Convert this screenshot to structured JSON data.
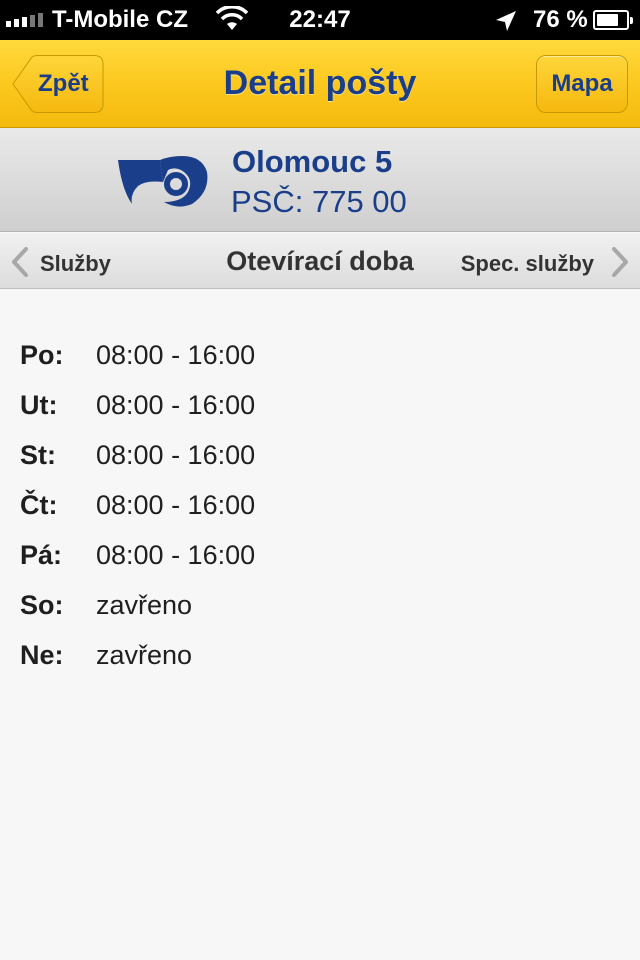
{
  "status_bar": {
    "carrier": "T-Mobile CZ",
    "time": "22:47",
    "battery": "76 %",
    "battery_level": 0.76
  },
  "nav": {
    "back_label": "Zpět",
    "title": "Detail pošty",
    "map_label": "Mapa",
    "accent_color": "#fcc81f",
    "text_color": "#1a3e8a"
  },
  "office": {
    "name": "Olomouc 5",
    "zip": "PSČ: 775 00",
    "logo_icon": "posthorn-icon"
  },
  "sections": {
    "prev_label": "Služby",
    "current_label": "Otevírací doba",
    "next_label": "Spec. služby"
  },
  "hours": [
    {
      "day": "Po:",
      "time": "08:00 - 16:00"
    },
    {
      "day": "Ut:",
      "time": "08:00 - 16:00"
    },
    {
      "day": "St:",
      "time": "08:00 - 16:00"
    },
    {
      "day": "Čt:",
      "time": "08:00 - 16:00"
    },
    {
      "day": "Pá:",
      "time": "08:00 - 16:00"
    },
    {
      "day": "So:",
      "time": "zavřeno"
    },
    {
      "day": "Ne:",
      "time": "zavřeno"
    }
  ]
}
